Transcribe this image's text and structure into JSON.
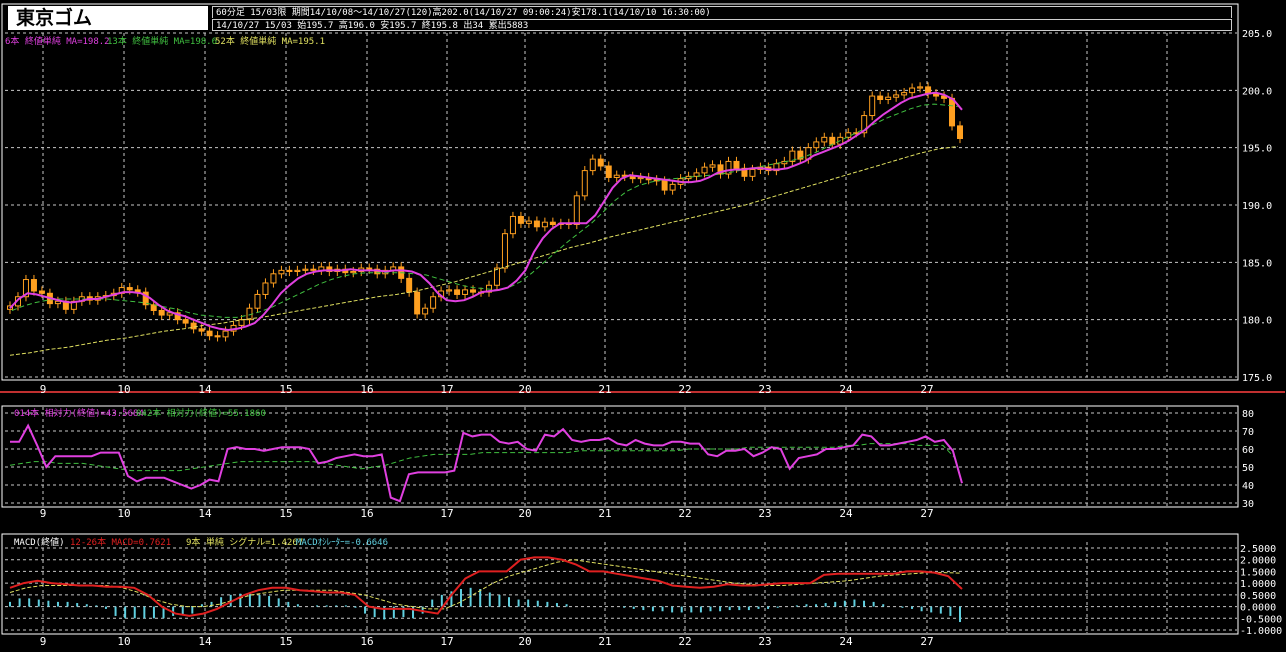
{
  "header": {
    "instrument": "東京ゴム",
    "line1": "60分足 15/03限 期間14/10/08〜14/10/27(120)高202.0(14/10/27 09:00:24)安178.1(14/10/10 16:30:00)",
    "line2": "14/10/27 15/03 始195.7 高196.0 安195.7 終195.8 出34 累出5883"
  },
  "colors": {
    "background": "#000000",
    "grid": "#c8c8c8",
    "ma6": "#e040e0",
    "ma13": "#40c040",
    "ma52": "#e0e060",
    "candle": "#ffa020",
    "rsi14": "#e040e0",
    "rsi42": "#40c040",
    "macd": "#e02020",
    "signal": "#e0e060",
    "oscillator": "#60d0e0"
  },
  "chart_data": [
    {
      "type": "candlestick",
      "panel": "price",
      "legend": [
        "6本 終値単純 MA=198.2",
        "13本 終値単純 MA=198.6",
        "52本 終値単純 MA=195.1"
      ],
      "x_labels": [
        "9",
        "10",
        "14",
        "15",
        "16",
        "17",
        "20",
        "21",
        "22",
        "23",
        "24",
        "27"
      ],
      "y_ticks": [
        "205.0",
        "200.0",
        "195.0",
        "190.0",
        "185.0",
        "180.0",
        "175.0"
      ],
      "ylim": [
        175,
        205
      ],
      "close": [
        181.2,
        182,
        183.5,
        182.5,
        182.3,
        181.4,
        181.6,
        180.9,
        181.6,
        182,
        181.7,
        182,
        182.1,
        182.3,
        182.8,
        182.6,
        182.4,
        181.3,
        180.8,
        180.4,
        180.6,
        180,
        179.7,
        179.2,
        179,
        178.6,
        178.5,
        179,
        179.5,
        180,
        181,
        182.2,
        183.2,
        184,
        184.3,
        184.2,
        184.3,
        184.4,
        184.3,
        184.6,
        184.2,
        184.4,
        184.1,
        184.2,
        184.5,
        184.4,
        184,
        184.3,
        184.6,
        183.6,
        182.4,
        180.5,
        181,
        182,
        182.5,
        182.6,
        182.2,
        182.6,
        182.4,
        182.4,
        183,
        184.5,
        187.5,
        189,
        188.4,
        188.6,
        188.1,
        188.5,
        188.3,
        188.4,
        188.3,
        190.8,
        193,
        194,
        193.4,
        192.4,
        192.6,
        192.5,
        192.3,
        192.4,
        192.2,
        192.1,
        191.3,
        191.8,
        192.3,
        192.5,
        192.8,
        193.3,
        193.5,
        192.7,
        193.8,
        193.2,
        192.5,
        193.1,
        193.3,
        193,
        193.6,
        193.8,
        194.7,
        194,
        195,
        195.5,
        195.9,
        195.3,
        195.9,
        196.3,
        196.3,
        197.8,
        199.5,
        199.2,
        199.4,
        199.6,
        199.8,
        200.2,
        200.3,
        199.7,
        199.5,
        199.3,
        196.9,
        195.8
      ],
      "ma6": [
        181,
        181.8,
        182.3,
        182.2,
        182,
        181.8,
        181.6,
        181.5,
        181.6,
        181.8,
        181.8,
        182,
        182.2,
        182.4,
        182.4,
        182.3,
        181.9,
        181.3,
        180.8,
        180.5,
        180.3,
        180,
        179.7,
        179.4,
        179.2,
        179.1,
        179.2,
        179.4,
        179.7,
        180.4,
        181.3,
        182.3,
        183,
        183.6,
        184,
        184.2,
        184.3,
        184.3,
        184.3,
        184.4,
        184.3,
        184.3,
        184.3,
        184.2,
        184.3,
        184.3,
        184.2,
        183.9,
        183.2,
        182.3,
        181.7,
        181.6,
        181.7,
        182,
        182.4,
        182.5,
        182.6,
        182.8,
        183.4,
        184.3,
        185.9,
        187.1,
        187.9,
        188.4,
        188.4,
        188.4,
        188.4,
        189.1,
        190.3,
        191.5,
        192.3,
        192.6,
        192.5,
        192.4,
        192.3,
        192.2,
        192.1,
        192,
        192,
        192.1,
        192.4,
        192.8,
        193,
        193.1,
        193.1,
        193.2,
        193.2,
        193.1,
        193.1,
        193.2,
        193.5,
        193.8,
        194.3,
        194.6,
        194.9,
        195.2,
        195.6,
        196.1,
        196.6,
        197.3,
        197.9,
        198.4,
        198.9,
        199.3,
        199.5,
        199.7,
        199.8,
        199.6,
        199.2,
        198.3
      ],
      "ma13": [
        180.8,
        181.2,
        181.5,
        181.7,
        181.8,
        181.8,
        181.8,
        181.8,
        181.8,
        181.7,
        181.6,
        181.5,
        181.3,
        181.1,
        180.9,
        180.6,
        180.4,
        180.3,
        180.2,
        180.2,
        180.4,
        180.7,
        181.1,
        181.6,
        182.1,
        182.6,
        183.1,
        183.5,
        183.8,
        184,
        184.1,
        184.1,
        184.1,
        184.1,
        184,
        183.9,
        183.6,
        183.3,
        183,
        182.8,
        182.7,
        182.6,
        182.8,
        183.3,
        184.1,
        185,
        185.9,
        186.8,
        187.6,
        188.4,
        189.4,
        190.4,
        191.2,
        191.7,
        192,
        192.2,
        192.3,
        192.4,
        192.5,
        192.6,
        192.7,
        192.9,
        193.1,
        193.3,
        193.5,
        193.7,
        193.9,
        194.2,
        194.6,
        195.1,
        195.6,
        196.1,
        196.6,
        197.1,
        197.6,
        198,
        198.4,
        198.7,
        198.8,
        198.7,
        198.6
      ],
      "ma52": [
        176.9,
        177.1,
        177.4,
        177.6,
        177.9,
        178.2,
        178.4,
        178.7,
        179,
        179.2,
        179.5,
        179.7,
        180,
        180.2,
        180.5,
        180.8,
        181.1,
        181.4,
        181.7,
        182,
        182.2,
        182.5,
        182.9,
        183.3,
        183.8,
        184.3,
        184.8,
        185.3,
        185.8,
        186.3,
        186.7,
        187.2,
        187.6,
        188,
        188.4,
        188.8,
        189.2,
        189.6,
        190,
        190.5,
        191,
        191.5,
        192,
        192.5,
        193,
        193.5,
        194,
        194.5,
        194.9,
        195.1
      ]
    },
    {
      "type": "line",
      "panel": "rsi",
      "legend": [
        "014本 相対力(終値)=43.5684",
        "042本 相対力(終値)=55.1860"
      ],
      "y_ticks": [
        "80",
        "70",
        "60",
        "50",
        "40",
        "30"
      ],
      "ylim": [
        30,
        80
      ],
      "rsi14": [
        64,
        64,
        73,
        62,
        50,
        56,
        56,
        56,
        56,
        56,
        58,
        58,
        58,
        45,
        42,
        44,
        44,
        44,
        42,
        40,
        38,
        40,
        43,
        42,
        60,
        61,
        60,
        60,
        59,
        60,
        61,
        61,
        61,
        60,
        52,
        53,
        55,
        56,
        57,
        56,
        56,
        57,
        33,
        31,
        46,
        47,
        47,
        47,
        47,
        48,
        69,
        67,
        68,
        68,
        64,
        63,
        64,
        60,
        59,
        68,
        67,
        71,
        65,
        64,
        65,
        65,
        66,
        63,
        62,
        65,
        63,
        62,
        62,
        64,
        64,
        63,
        63,
        57,
        56,
        59,
        59,
        60,
        56,
        58,
        61,
        60,
        49,
        55,
        56,
        57,
        60,
        60,
        61,
        62,
        68,
        67,
        62,
        62,
        63,
        64,
        65,
        67,
        64,
        65,
        59,
        41
      ],
      "rsi42": [
        51,
        52,
        53,
        53,
        52,
        52,
        52,
        51,
        50,
        49,
        48,
        48,
        48,
        48,
        48,
        49,
        50,
        51,
        52,
        53,
        53,
        53,
        53,
        53,
        53,
        53,
        52,
        51,
        50,
        49,
        50,
        51,
        53,
        55,
        56,
        57,
        57,
        57,
        57,
        58,
        58,
        58,
        58,
        58,
        58,
        58,
        58,
        59,
        59,
        59,
        59,
        59,
        59,
        59,
        59,
        59,
        60,
        60,
        60,
        60,
        60,
        61,
        61,
        61,
        61,
        61,
        61,
        61,
        61,
        62,
        62,
        63,
        63,
        63,
        63,
        62,
        62,
        62,
        55
      ]
    },
    {
      "type": "line",
      "panel": "macd",
      "legend": [
        "MACD(終値)",
        "12-26本 MACD=0.7621",
        "9本 単純 シグナル=1.4267",
        "MACDｵｼﾚｰﾀｰ=-0.6646"
      ],
      "y_ticks": [
        "2.5000",
        "2.0000",
        "1.5000",
        "1.0000",
        "0.5000",
        "0.0000",
        "-0.5000",
        "-1.0000"
      ],
      "ylim": [
        -1,
        2.5
      ],
      "macd": [
        0.8,
        1,
        1.1,
        1,
        0.95,
        0.9,
        0.9,
        0.85,
        0.85,
        0.8,
        0.5,
        0,
        -0.3,
        -0.4,
        -0.3,
        -0.1,
        0.2,
        0.5,
        0.7,
        0.8,
        0.8,
        0.7,
        0.65,
        0.6,
        0.6,
        0.5,
        0,
        -0.1,
        -0.1,
        -0.1,
        -0.2,
        -0.3,
        0.5,
        1.2,
        1.5,
        1.5,
        1.5,
        2,
        2.1,
        2.1,
        2,
        1.8,
        1.5,
        1.5,
        1.4,
        1.3,
        1.2,
        1.1,
        0.9,
        0.85,
        0.8,
        0.85,
        0.95,
        0.9,
        0.9,
        0.95,
        1,
        1,
        1,
        1.35,
        1.4,
        1.4,
        1.4,
        1.4,
        1.4,
        1.5,
        1.5,
        1.45,
        1.3,
        0.75
      ],
      "signal": [
        0.6,
        0.8,
        0.9,
        0.9,
        0.9,
        0.9,
        0.9,
        0.8,
        0.6,
        0.3,
        0.1,
        0,
        0,
        0.1,
        0.3,
        0.5,
        0.6,
        0.7,
        0.7,
        0.7,
        0.7,
        0.6,
        0.5,
        0.3,
        0.1,
        0,
        -0.1,
        -0.1,
        0.2,
        0.6,
        1,
        1.3,
        1.5,
        1.7,
        1.9,
        2,
        1.9,
        1.8,
        1.7,
        1.6,
        1.5,
        1.4,
        1.3,
        1.2,
        1.1,
        1,
        0.95,
        0.9,
        0.9,
        0.95,
        1,
        1.05,
        1.1,
        1.2,
        1.3,
        1.35,
        1.4,
        1.45,
        1.45,
        1.43
      ],
      "oscillator": [
        0.2,
        0.35,
        0.35,
        0.3,
        0.25,
        0.2,
        0.2,
        0.15,
        0.1,
        0.05,
        -0.1,
        -0.4,
        -0.5,
        -0.5,
        -0.5,
        -0.5,
        -0.5,
        -0.4,
        -0.35,
        -0.3,
        0.1,
        0.2,
        0.4,
        0.5,
        0.55,
        0.55,
        0.5,
        0.45,
        0.35,
        0.2,
        0.1,
        0,
        0.05,
        0.05,
        0.05,
        0.05,
        -0.05,
        -0.3,
        -0.45,
        -0.55,
        -0.5,
        -0.45,
        -0.5,
        -0.3,
        0.3,
        0.5,
        0.65,
        0.75,
        0.8,
        0.75,
        0.6,
        0.5,
        0.4,
        0.3,
        0.3,
        0.25,
        0.2,
        0.15,
        0.1,
        0,
        0,
        0,
        0,
        0,
        -0.05,
        -0.1,
        -0.15,
        -0.2,
        -0.2,
        -0.25,
        -0.25,
        -0.25,
        -0.25,
        -0.2,
        -0.2,
        -0.15,
        -0.15,
        -0.15,
        -0.1,
        -0.1,
        -0.05,
        0,
        0.05,
        0.1,
        0.1,
        0.15,
        0.2,
        0.25,
        0.3,
        0.25,
        0.2,
        0.1,
        0,
        -0.05,
        -0.1,
        -0.2,
        -0.25,
        -0.3,
        -0.4,
        -0.66
      ]
    }
  ]
}
